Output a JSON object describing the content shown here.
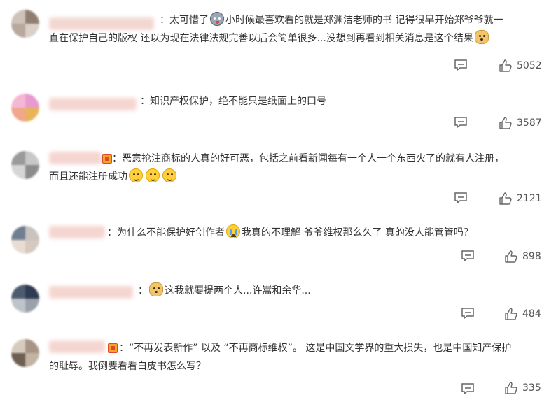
{
  "comments": [
    {
      "segments": [
        "：太可惜了",
        "小时候最喜欢看的就是郑渊洁老师的书 记得很早开始郑爷爷就一",
        "直在保护自己的版权 还以为现在法律法规完善以后会简单很多...没想到再看到相关消息是这个结果"
      ],
      "likes": "5052"
    },
    {
      "segments": [
        "：知识产权保护，绝不能只是纸面上的口号"
      ],
      "likes": "3587"
    },
    {
      "segments": [
        "：恶意抢注商标的人真的好可恶，包括之前看新闻每有一个人一个东西火了的就有人注册，",
        "而且还能注册成功"
      ],
      "likes": "2121"
    },
    {
      "segments": [
        "：为什么不能保护好创作者",
        "我真的不理解 爷爷维权那么久了 真的没人能管管吗？"
      ],
      "likes": "898"
    },
    {
      "segments": [
        "：",
        "这我就要提两个人...许嵩和余华..."
      ],
      "likes": "484"
    },
    {
      "segments": [
        "：“不再发表新作” 以及 “不再商标维权”。 这是中国文学界的重大损失，也是中国知产保护",
        "的耻辱。我倒要看看白皮书怎么写？"
      ],
      "likes": "335"
    }
  ],
  "icons": {
    "comment": "comment-bubble-icon",
    "like": "thumbs-up-icon",
    "emoji_dog": "husky-emoji-icon",
    "emoji_smile": "smile-emoji-icon",
    "emoji_cry": "crying-emoji-icon",
    "emoji_doge": "doge-emoji-icon",
    "badge": "fan-badge-icon"
  },
  "colors": {
    "text": "#333333",
    "meta": "#555555",
    "icon": "#666666"
  }
}
